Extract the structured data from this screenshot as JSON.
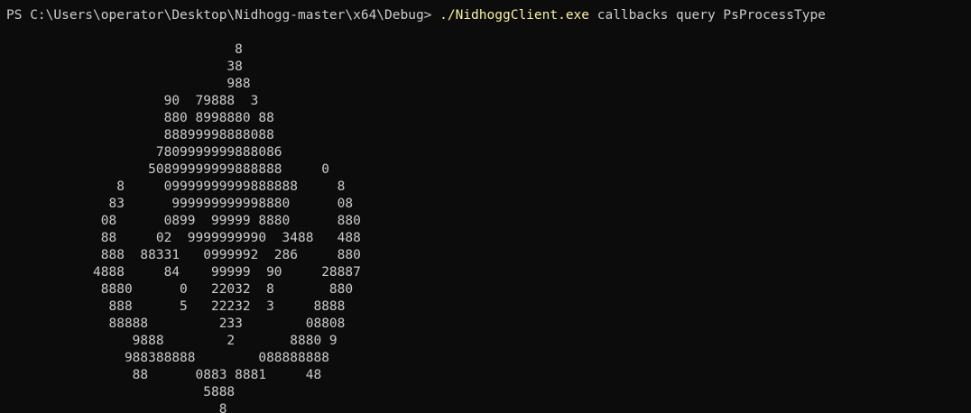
{
  "terminal": {
    "prompt": "PS C:\\Users\\operator\\Desktop\\Nidhogg-master\\x64\\Debug> ",
    "command_exe": "./NidhoggClient.exe",
    "command_args": " callbacks query PsProcessType",
    "colors": {
      "background": "#0c0c0c",
      "text": "#cccccc",
      "command": "#f9f1a5"
    },
    "output_lines": [
      "                             8",
      "                            38",
      "                            988",
      "                    90  79888  3",
      "                    880 8998880 88",
      "                    88899998888088",
      "                   7809999999888086",
      "                  50899999999888888     0",
      "              8     09999999999888888     8",
      "             83      999999999998880      08",
      "            08      0899  99999 8880      880",
      "            88     02  9999999990  3488   488",
      "            888  88331   0999992  286     880",
      "           4888     84    99999  90     28887",
      "            8880      0   22032  8       880",
      "             888      5   22232  3     8888",
      "             88888         233        08808",
      "                9888        2       8880 9",
      "               988388888        088888888",
      "                88      0883 8881     48",
      "                         5888",
      "                           8"
    ]
  }
}
